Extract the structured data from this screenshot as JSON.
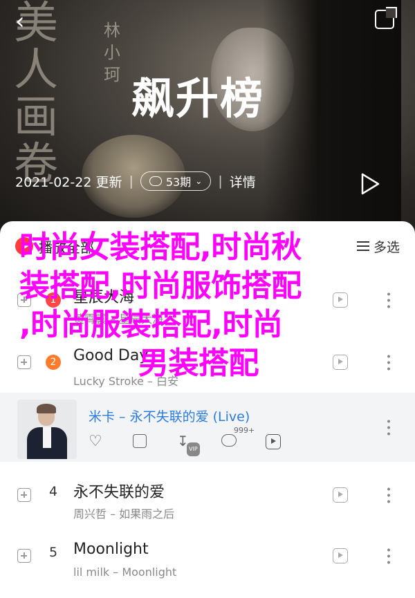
{
  "header": {
    "calligraphy_text": "美人画卷",
    "calligraphy_artist": "林小珂",
    "title": "飙升榜",
    "date": "2021-02-22 更新",
    "comment_count": "53期",
    "details": "详情"
  },
  "sheet": {
    "play_all": "播放全部",
    "multi_select": "多选"
  },
  "songs": [
    {
      "rank": "1",
      "title": "星辰大海",
      "artist": "黄霄雲 – 星辰大海",
      "badge_color": "#ff4747"
    },
    {
      "rank": "2",
      "title": "Good Day",
      "artist": "Lucky Stroke – 白安",
      "badge_color": "#ff7a2a"
    },
    {
      "rank": "4",
      "title": "永不失联的爱",
      "artist": "周兴哲 – 如果雨之后"
    },
    {
      "rank": "5",
      "title": "Moonlight",
      "artist": "lil milk – Moonlight"
    }
  ],
  "featured": {
    "title": "米卡 – 永不失联的爱 (Live)",
    "comment_count": "999+",
    "vip": "VIP"
  },
  "overlay": {
    "line1": "时尚女装搭配,时尚秋",
    "line2": "装搭配,时尚服饰搭配",
    "line3": ",时尚服装搭配,时尚",
    "line4": "男装搭配"
  }
}
